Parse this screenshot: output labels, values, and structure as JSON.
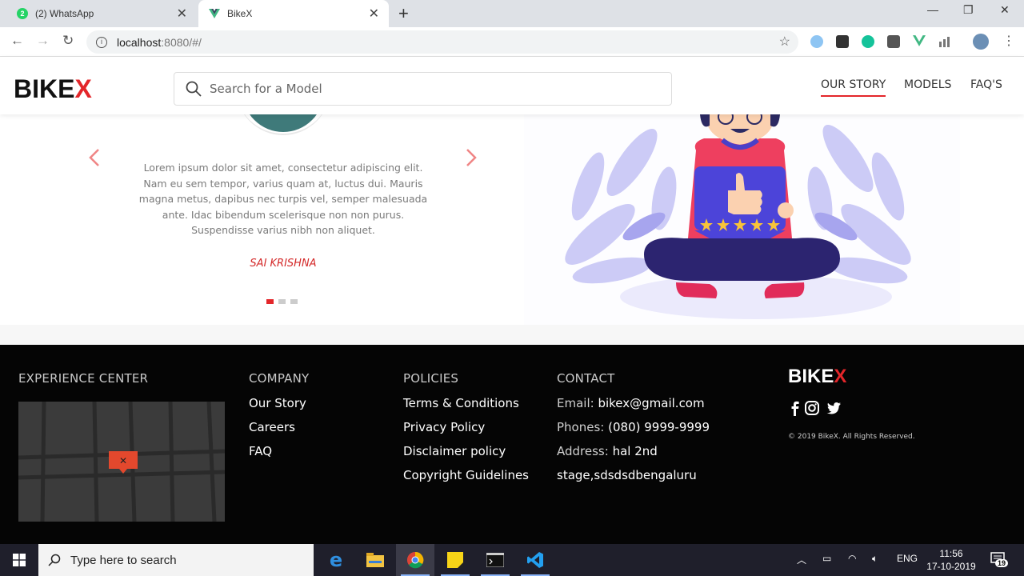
{
  "browser": {
    "tabs": [
      {
        "title": "(2) WhatsApp",
        "badge": "2",
        "active": false
      },
      {
        "title": "BikeX",
        "active": true
      }
    ],
    "url_host": "localhost",
    "url_path": ":8080/#/"
  },
  "header": {
    "logo_main": "BIKE",
    "logo_accent": "X",
    "search_placeholder": "Search for a Model",
    "nav": [
      {
        "label": "OUR STORY",
        "active": true
      },
      {
        "label": "MODELS",
        "active": false
      },
      {
        "label": "FAQ'S",
        "active": false
      }
    ]
  },
  "testimonial": {
    "quote": "Lorem ipsum dolor sit amet, consectetur adipiscing elit. Nam eu sem tempor, varius quam at, luctus dui. Mauris magna metus, dapibus nec turpis vel, semper malesuada ante. Idac bibendum scelerisque non non purus. Suspendisse varius nibh non aliquet.",
    "author": "SAI KRISHNA",
    "slide_count": 3,
    "active_slide": 1
  },
  "footer": {
    "experience": {
      "heading": "EXPERIENCE CENTER"
    },
    "company": {
      "heading": "COMPANY",
      "links": [
        "Our Story",
        "Careers",
        "FAQ"
      ]
    },
    "policies": {
      "heading": "POLICIES",
      "links": [
        "Terms & Conditions",
        "Privacy Policy",
        "Disclaimer policy",
        "Copyright Guidelines"
      ]
    },
    "contact": {
      "heading": "CONTACT",
      "email_label": "Email:",
      "email": "bikex@gmail.com",
      "phone_label": "Phones:",
      "phone": "(080) 9999-9999",
      "address_label": "Address:",
      "address_line1": "hal 2nd",
      "address_line2": "stage,sdsdsdbengaluru"
    },
    "logo_main": "BIKE",
    "logo_accent": "X",
    "copyright": "© 2019 BikeX. All Rights Reserved."
  },
  "taskbar": {
    "search_placeholder": "Type here to search",
    "language": "ENG",
    "time": "11:56",
    "date": "17-10-2019",
    "notifications": "19"
  },
  "colors": {
    "accent": "#e3262a",
    "footer_bg": "#050505"
  }
}
